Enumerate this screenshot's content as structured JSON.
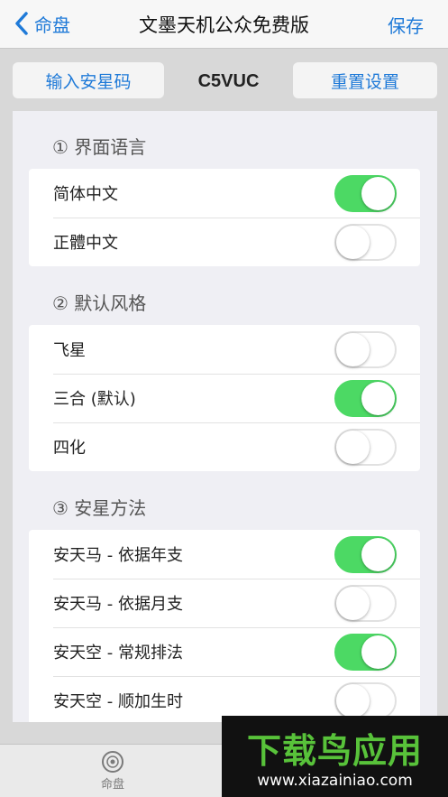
{
  "navbar": {
    "back_label": "命盘",
    "title": "文墨天机公众免费版",
    "save_label": "保存"
  },
  "codebar": {
    "enter_label": "输入安星码",
    "code": "C5VUC",
    "reset_label": "重置设置"
  },
  "sections": [
    {
      "title": "① 界面语言",
      "rows": [
        {
          "label": "简体中文",
          "on": true
        },
        {
          "label": "正體中文",
          "on": false
        }
      ]
    },
    {
      "title": "② 默认风格",
      "rows": [
        {
          "label": "飞星",
          "on": false
        },
        {
          "label": "三合 (默认)",
          "on": true
        },
        {
          "label": "四化",
          "on": false
        }
      ]
    },
    {
      "title": "③ 安星方法",
      "rows": [
        {
          "label": "安天马 - 依据年支",
          "on": true
        },
        {
          "label": "安天马 - 依据月支",
          "on": false
        },
        {
          "label": "安天空 - 常规排法",
          "on": true
        },
        {
          "label": "安天空 - 顺加生时",
          "on": false
        }
      ]
    }
  ],
  "tabbar": {
    "item_label": "命盘",
    "item_icon": "disc-icon"
  },
  "watermark": {
    "main": "下载鸟应用",
    "url": "www.xiazainiao.com"
  },
  "colors": {
    "accent": "#1f7ad8",
    "toggle_on": "#4cd964",
    "watermark_green": "#58c23a"
  }
}
